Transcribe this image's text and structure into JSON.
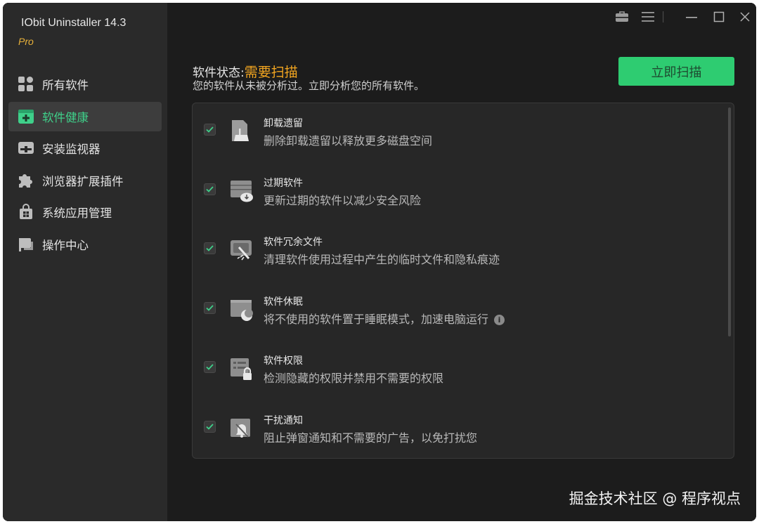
{
  "app": {
    "title": "IObit Uninstaller 14.3",
    "edition": "Pro"
  },
  "sidebar": {
    "items": [
      {
        "label": "所有软件",
        "icon": "grid-icon",
        "active": false
      },
      {
        "label": "软件健康",
        "icon": "health-plus-icon",
        "active": true
      },
      {
        "label": "安装监视器",
        "icon": "monitor-icon",
        "active": false
      },
      {
        "label": "浏览器扩展插件",
        "icon": "puzzle-icon",
        "active": false
      },
      {
        "label": "系统应用管理",
        "icon": "store-bag-icon",
        "active": false
      },
      {
        "label": "操作中心",
        "icon": "flag-icon",
        "active": false
      }
    ]
  },
  "titlebar": {
    "icons": [
      "toolbox-icon",
      "menu-icon",
      "minimize-icon",
      "maximize-icon",
      "close-icon"
    ]
  },
  "status": {
    "label": "软件状态:",
    "value": "需要扫描",
    "description": "您的软件从未被分析过。立即分析您的所有软件。"
  },
  "scan_button": {
    "label": "立即扫描"
  },
  "health_items": [
    {
      "title": "卸载遗留",
      "description": "删除卸载遗留以释放更多磁盘空间",
      "checked": true,
      "icon": "broom-file-icon",
      "info": false
    },
    {
      "title": "过期软件",
      "description": "更新过期的软件以减少安全风险",
      "checked": true,
      "icon": "cloud-update-icon",
      "info": false
    },
    {
      "title": "软件冗余文件",
      "description": "清理软件使用过程中产生的临时文件和隐私痕迹",
      "checked": true,
      "icon": "clean-brush-icon",
      "info": false
    },
    {
      "title": "软件休眠",
      "description": "将不使用的软件置于睡眠模式，加速电脑运行",
      "checked": true,
      "icon": "sleep-moon-icon",
      "info": true
    },
    {
      "title": "软件权限",
      "description": "检测隐藏的权限并禁用不需要的权限",
      "checked": true,
      "icon": "permission-lock-icon",
      "info": false
    },
    {
      "title": "干扰通知",
      "description": "阻止弹窗通知和不需要的广告，以免打扰您",
      "checked": true,
      "icon": "bell-off-icon",
      "info": false
    }
  ],
  "colors": {
    "accent_green": "#2ecc71",
    "status_orange": "#f2a520",
    "edition_gold": "#e8b13a",
    "background": "#1c1c1c"
  },
  "watermark": "掘金技术社区 @ 程序视点"
}
